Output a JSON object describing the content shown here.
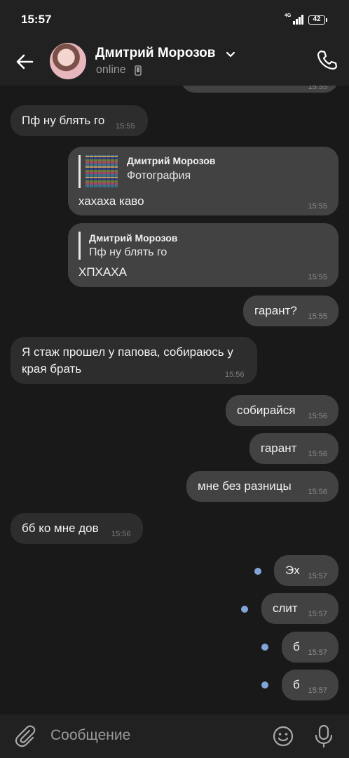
{
  "status_bar": {
    "time": "15:57",
    "network": "4G",
    "battery": "42"
  },
  "header": {
    "contact_name": "Дмитрий Морозов",
    "status": "online"
  },
  "messages": [
    {
      "dir": "out",
      "text": "",
      "time": "15:55"
    },
    {
      "dir": "in",
      "text": "Пф ну блять го",
      "time": "15:55"
    },
    {
      "dir": "out",
      "reply_name": "Дмитрий Морозов",
      "reply_text": "Фотография",
      "text": "хахаха каво",
      "time": "15:55"
    },
    {
      "dir": "out",
      "reply_name": "Дмитрий Морозов",
      "reply_text": "Пф ну блять го",
      "text": "ХПХАХА",
      "time": "15:55"
    },
    {
      "dir": "out",
      "text": "гарант?",
      "time": "15:55"
    },
    {
      "dir": "in",
      "text": "Я стаж прошел у папова, собираюсь у",
      "text2": "края брать",
      "time": "15:56"
    },
    {
      "dir": "out",
      "text": "собирайся",
      "time": "15:56"
    },
    {
      "dir": "out",
      "text": "гарант",
      "time": "15:56"
    },
    {
      "dir": "out",
      "text": "мне без разницы",
      "time": "15:56"
    },
    {
      "dir": "in",
      "text": "бб ко мне дов",
      "time": "15:56"
    },
    {
      "dir": "out",
      "text": "Эх",
      "time": "15:57",
      "unread": true
    },
    {
      "dir": "out",
      "text": "слит",
      "time": "15:57",
      "unread": true
    },
    {
      "dir": "out",
      "text": "б",
      "time": "15:57",
      "unread": true
    },
    {
      "dir": "out",
      "text": "б",
      "time": "15:57",
      "unread": true
    }
  ],
  "composer": {
    "placeholder": "Сообщение"
  },
  "icons": [
    "back-arrow-icon",
    "chevron-down-icon",
    "mobile-device-icon",
    "phone-icon",
    "paperclip-icon",
    "emoji-icon",
    "microphone-icon"
  ],
  "colors": {
    "background": "#191919",
    "bar": "#212121",
    "incoming_bubble": "#2d2d2d",
    "outgoing_bubble": "#424242",
    "unread_dot": "#7fa6d8"
  }
}
